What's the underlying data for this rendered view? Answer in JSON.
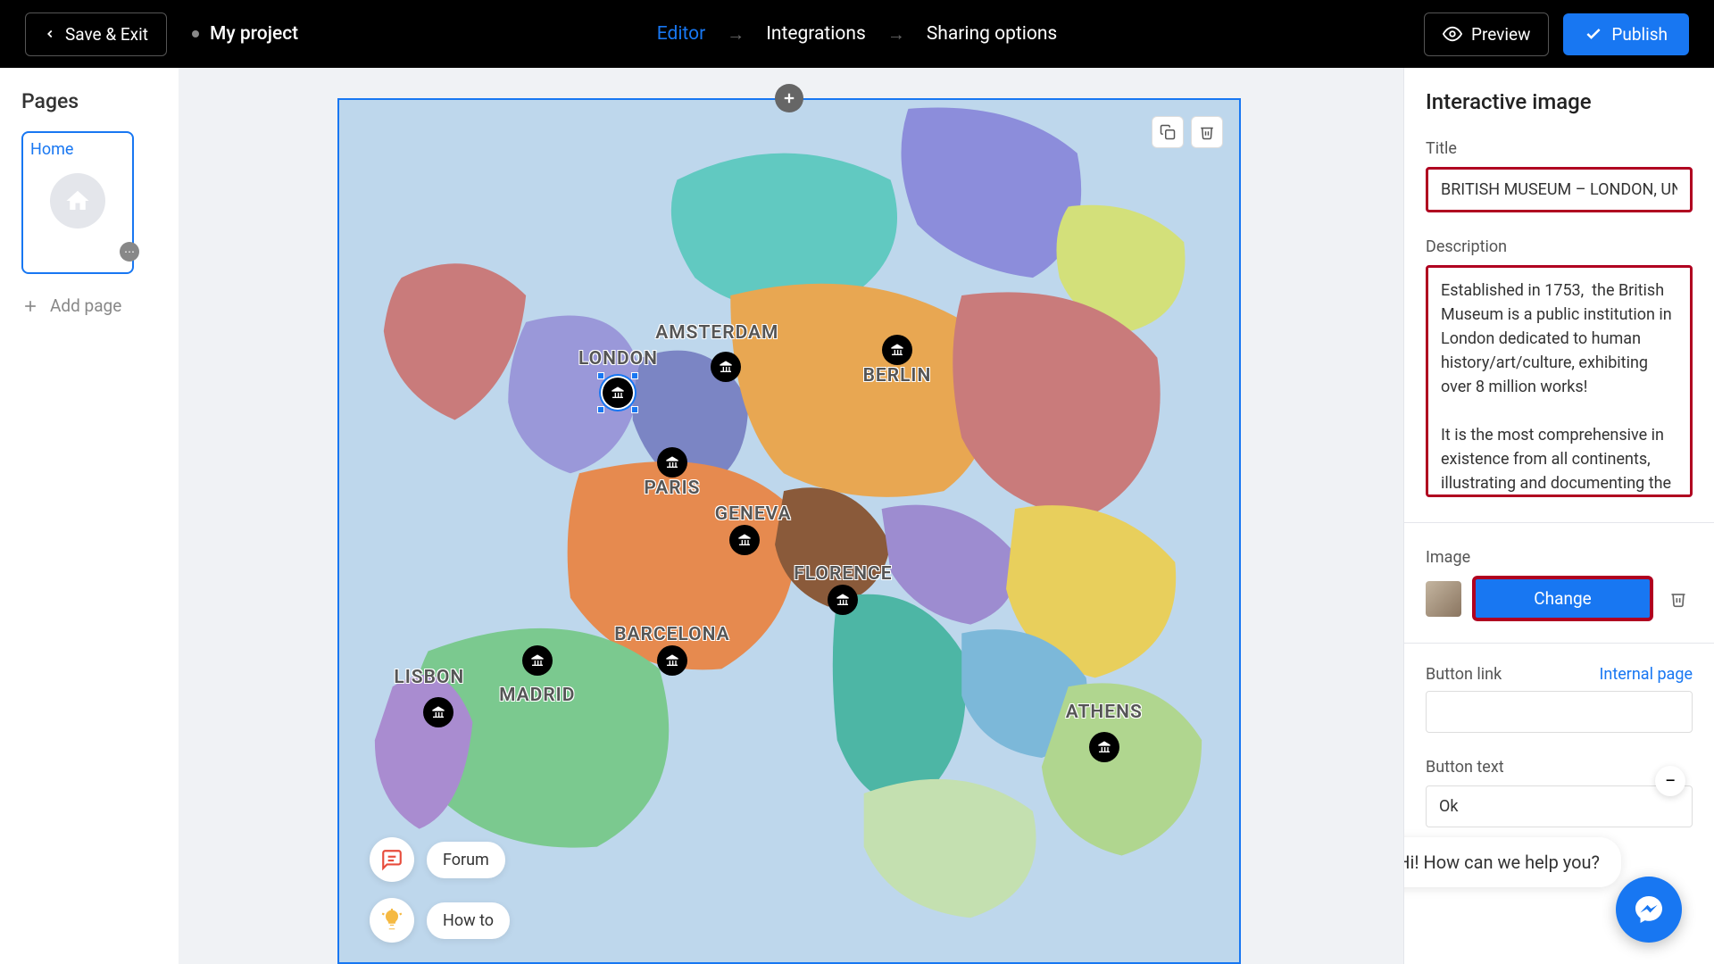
{
  "topbar": {
    "save_exit": "Save & Exit",
    "project_name": "My project",
    "nav": {
      "editor": "Editor",
      "integrations": "Integrations",
      "sharing": "Sharing options"
    },
    "preview": "Preview",
    "publish": "Publish"
  },
  "sidebar_left": {
    "heading": "Pages",
    "page_home": "Home",
    "add_page": "Add page"
  },
  "map": {
    "cities": {
      "london": "LONDON",
      "amsterdam": "AMSTERDAM",
      "berlin": "BERLIN",
      "paris": "PARIS",
      "geneva": "GENEVA",
      "florence": "FLORENCE",
      "barcelona": "BARCELONA",
      "madrid": "MADRID",
      "lisbon": "LISBON",
      "athens": "ATHENS"
    }
  },
  "help": {
    "forum": "Forum",
    "howto": "How to"
  },
  "panel": {
    "title": "Interactive image",
    "label_title": "Title",
    "title_value": "BRITISH MUSEUM – LONDON, UNI",
    "label_description": "Description",
    "description_value": "Established in 1753,  the British Museum is a public institution in London dedicated to human history/art/culture, exhibiting over 8 million works!\n\nIt is the most comprehensive in existence from all continents, illustrating and documenting the story of human culture from its beginnings to the present.",
    "label_image": "Image",
    "change": "Change",
    "label_button_link": "Button link",
    "internal_page": "Internal page",
    "label_button_text": "Button text",
    "button_text_value": "Ok"
  },
  "chat": {
    "greeting": "Hi! How can we help you?"
  }
}
